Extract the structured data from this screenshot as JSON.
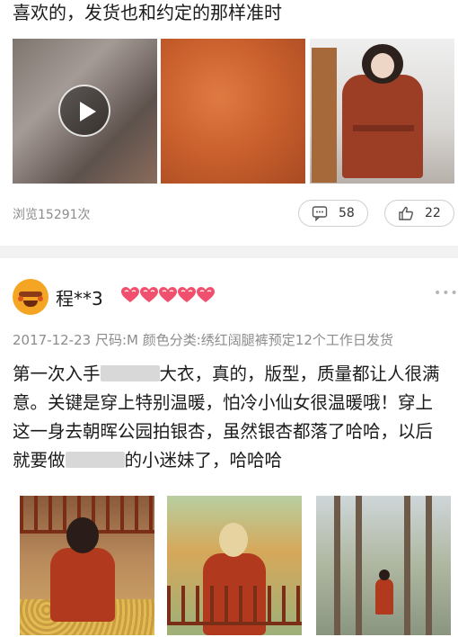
{
  "review_top": {
    "text": "喜欢的，发货也和约定的那样准时",
    "views": "浏览15291次",
    "comment_count": "58",
    "like_count": "22"
  },
  "review": {
    "username": "程**3",
    "rank_hearts": 5,
    "date": "2017-12-23",
    "size": "尺码:M",
    "color_spec": "颜色分类:绣红阔腿裤预定12个工作日发货",
    "body_part1": "第一次入手",
    "body_part2": "大衣，真的，版型，质量都让人很满意。关键是穿上特别温暖，怕冷小仙女很温暖哦！穿上这一身去朝晖公园拍银杏，虽然银杏都落了哈哈，以后就要做",
    "body_part3": "的小迷妹了，哈哈哈"
  },
  "colors": {
    "heart": "#f0506e",
    "muted_text": "#8c8c8c",
    "divider": "#f2f2f2"
  }
}
